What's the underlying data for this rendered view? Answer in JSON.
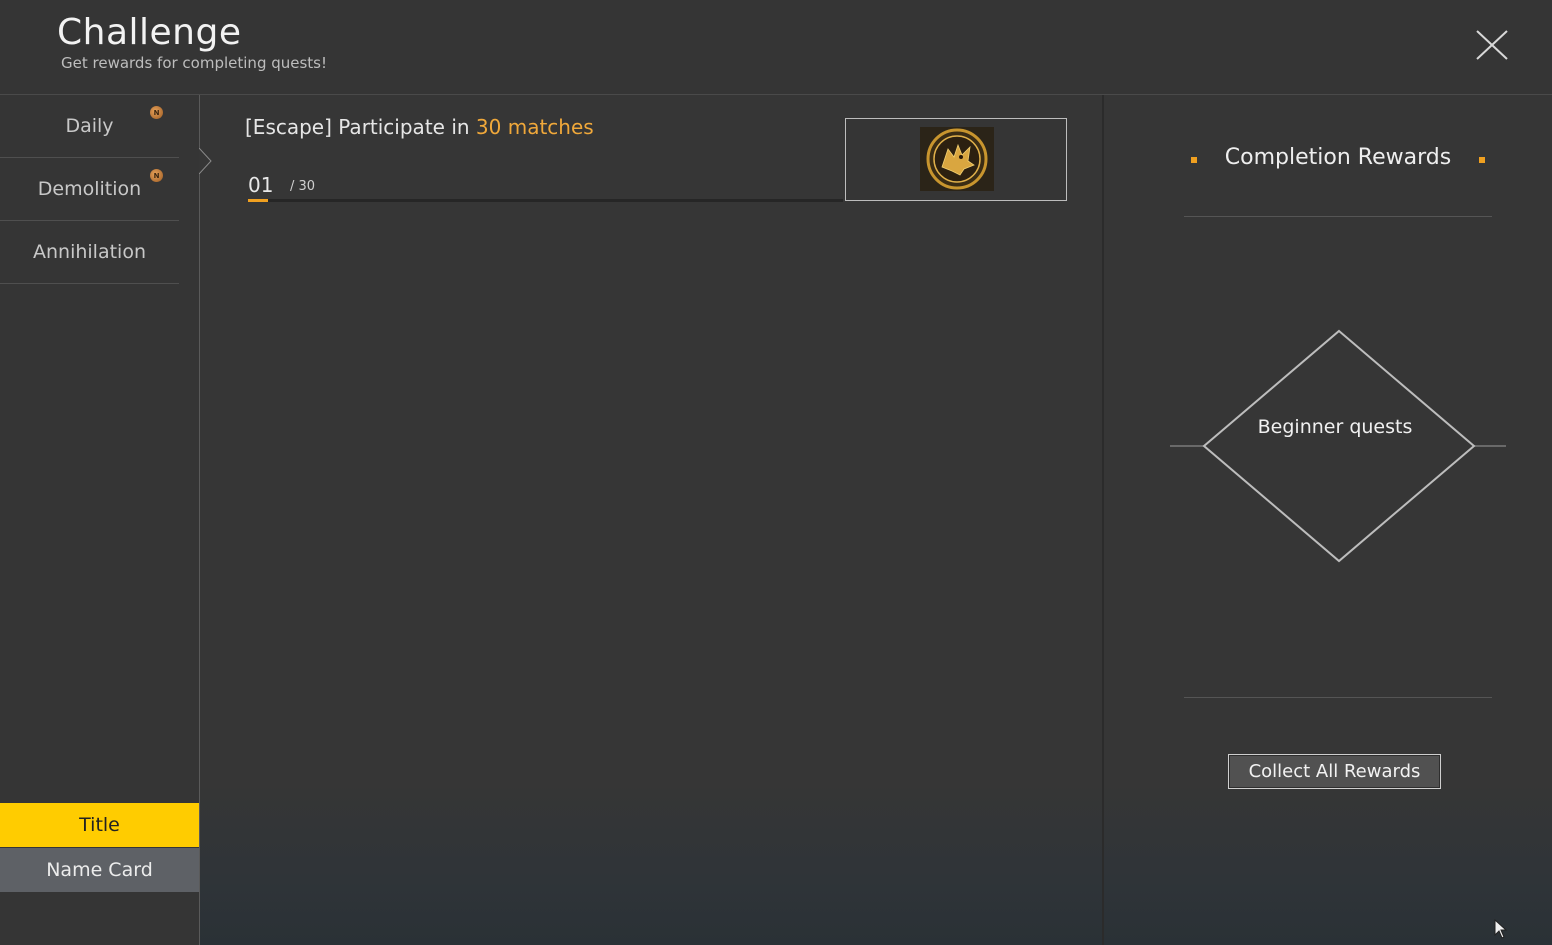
{
  "header": {
    "title": "Challenge",
    "subtitle": "Get rewards for completing quests!"
  },
  "sidebar": {
    "tabs": [
      {
        "label": "Daily",
        "badge": "N"
      },
      {
        "label": "Demolition",
        "badge": "N"
      },
      {
        "label": "Annihilation"
      }
    ],
    "categories": [
      {
        "label": "Title",
        "selected": true
      },
      {
        "label": "Name Card",
        "selected": false
      }
    ]
  },
  "quest": {
    "prefix": "[Escape] Participate in ",
    "highlight": "30 matches",
    "progress_current": "01",
    "progress_max": "/ 30",
    "progress_fraction": 0.0333,
    "reward_icon": "gold-dragon-emblem-icon"
  },
  "rewards_panel": {
    "title": "Completion Rewards",
    "diamond_label": "Beginner quests",
    "collect_label": "Collect All Rewards"
  },
  "colors": {
    "accent": "#f0a83a",
    "selected_tab": "#ffcc00",
    "progress": "#f0a020"
  }
}
